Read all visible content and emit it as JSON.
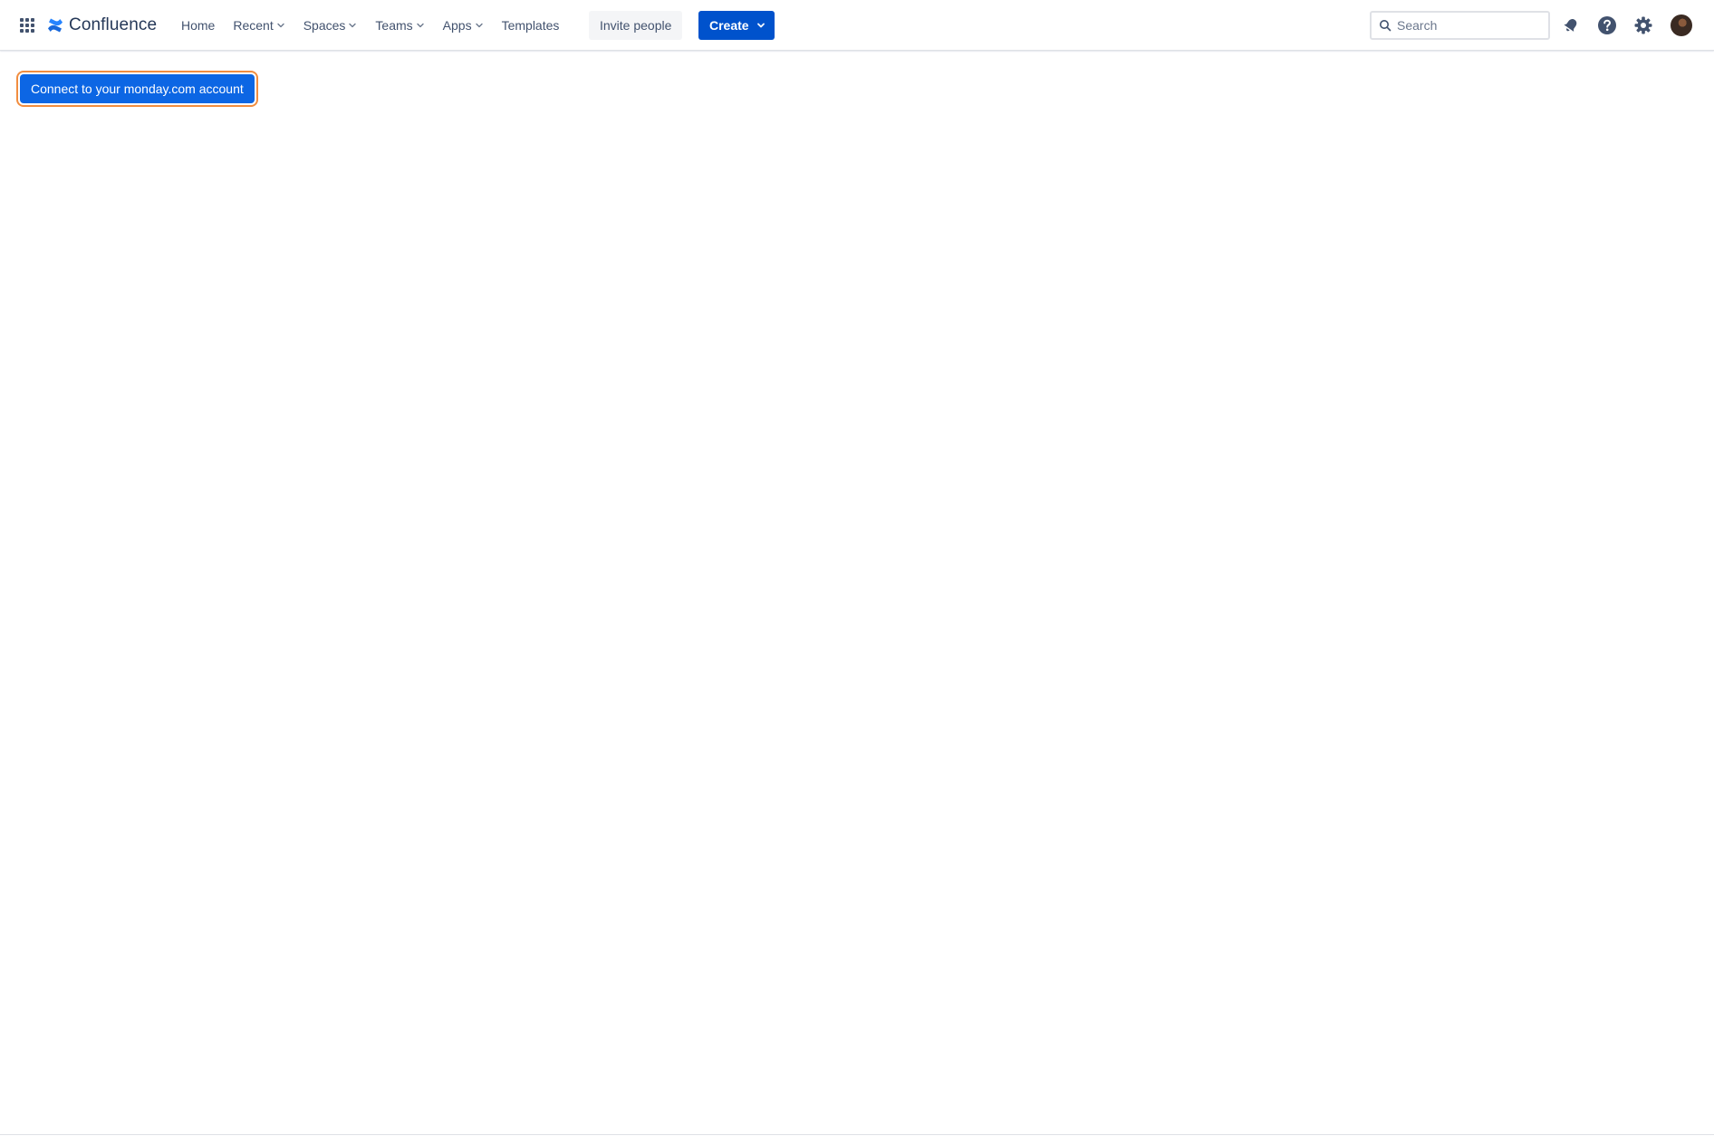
{
  "app": {
    "name": "Confluence",
    "brand_color": "#0052cc"
  },
  "nav": {
    "items": [
      {
        "label": "Home",
        "has_dropdown": false
      },
      {
        "label": "Recent",
        "has_dropdown": true
      },
      {
        "label": "Spaces",
        "has_dropdown": true
      },
      {
        "label": "Teams",
        "has_dropdown": true
      },
      {
        "label": "Apps",
        "has_dropdown": true
      },
      {
        "label": "Templates",
        "has_dropdown": false
      }
    ],
    "invite_label": "Invite people",
    "create_label": "Create"
  },
  "search": {
    "placeholder": "Search",
    "value": ""
  },
  "icons": {
    "app_switcher": "grid-icon",
    "notifications": "bell-icon",
    "help": "question-circle-icon",
    "settings": "gear-icon"
  },
  "main": {
    "connect_label": "Connect to your monday.com account",
    "connect_color": "#0c66e4",
    "focus_ring_color": "#f18d3f"
  }
}
